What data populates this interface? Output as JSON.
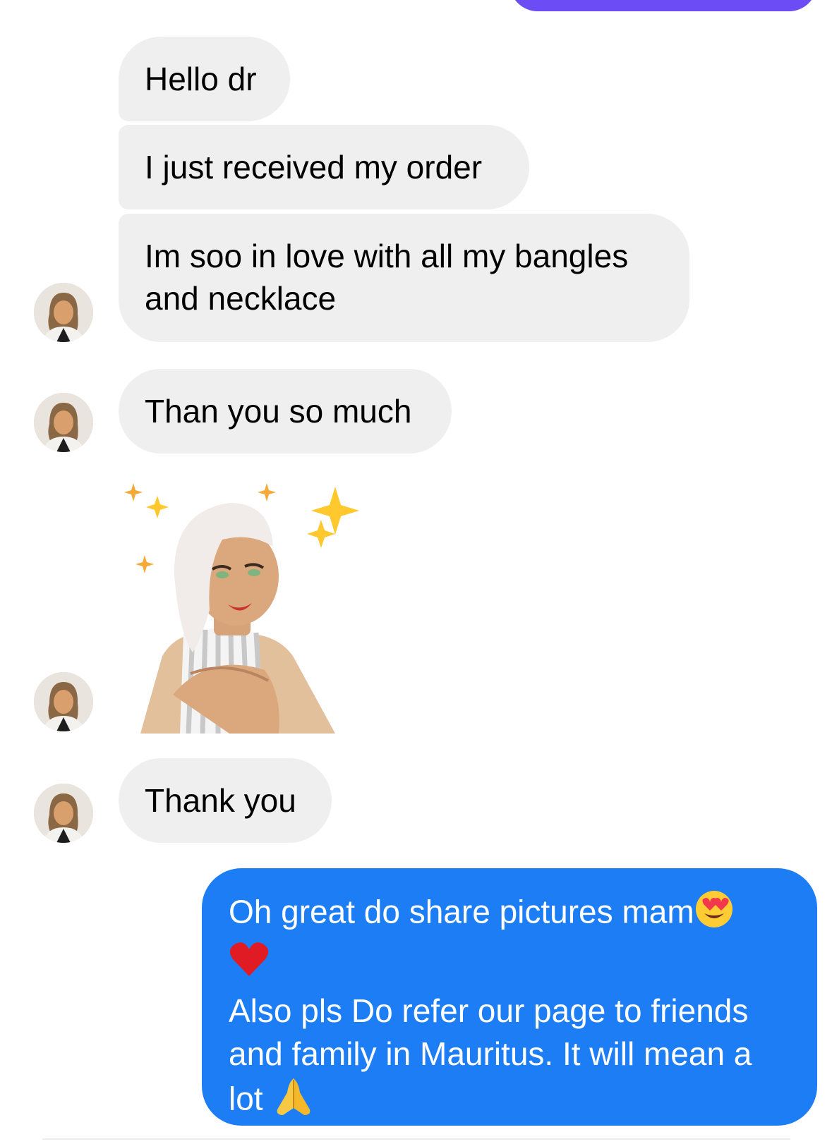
{
  "thread": {
    "received": [
      {
        "text": "Hello dr"
      },
      {
        "text": "I just received my order"
      },
      {
        "text": "Im soo in love with all my bangles and necklace"
      },
      {
        "text": "Than you so much"
      },
      {
        "text": "Thank you"
      }
    ],
    "sticker": {
      "icon": "memoji-hands-on-heart-sticker"
    },
    "sent": {
      "line1": "Oh great do share pictures mam",
      "line1_emoji": "heart-eyes-emoji",
      "line2_emoji": "red-heart-emoji",
      "line3": "Also pls Do refer our page to friends",
      "line4": "and family in Mauritus. It will mean a",
      "line5": "lot",
      "line5_emoji": "folded-hands-emoji"
    }
  },
  "colors": {
    "sent_bubble": "#1c7df5",
    "received_bubble": "#efeff0",
    "top_sent_bubble": "#6b4cf5"
  }
}
